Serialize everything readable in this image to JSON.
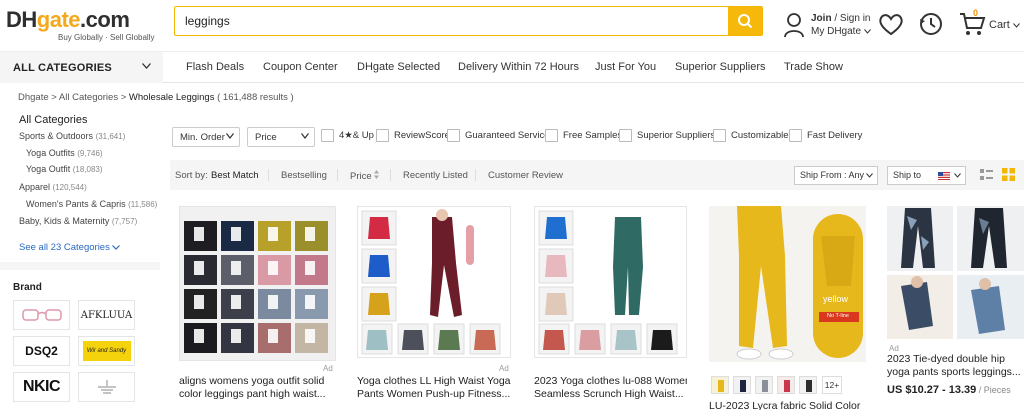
{
  "header": {
    "logo": {
      "dh": "DH",
      "gate": "gate",
      "com": ".com",
      "tagline": "Buy Globally · Sell Globally"
    },
    "search_value": "leggings",
    "user_line1": "Join",
    "user_line1_rest": " / Sign in",
    "user_line2": "My DHgate",
    "cart_count": "0",
    "cart_label": "Cart"
  },
  "nav": {
    "all_categories": "ALL CATEGORIES",
    "items": [
      "Flash Deals",
      "Coupon Center",
      "DHgate Selected",
      "Delivery Within 72 Hours",
      "Just For You",
      "Superior Suppliers",
      "Trade Show"
    ]
  },
  "breadcrumb": {
    "path": "Dhgate > All Categories > ",
    "current": "Wholesale Leggings",
    "count": " ( 161,488  results )"
  },
  "sidebar": {
    "title": "All Categories",
    "items": [
      {
        "label": "Sports & Outdoors",
        "count": "(31,641)"
      },
      {
        "label": "Yoga Outfits",
        "count": "(9,746)"
      },
      {
        "label": "Yoga Outfit",
        "count": "(18,083)"
      },
      {
        "label": "Apparel",
        "count": "(120,544)"
      },
      {
        "label": "Women's Pants & Capris",
        "count": "(11,586)"
      },
      {
        "label": "Baby, Kids & Maternity",
        "count": "(7,757)"
      }
    ],
    "see_all": "See all 23 Categories",
    "brand_title": "Brand",
    "brands": [
      "",
      "AFKLUUA",
      "DSQ2",
      "Wir and Sandy",
      "NKIC",
      ""
    ]
  },
  "filters": {
    "min_order": "Min. Order",
    "price": "Price",
    "checkboxes": [
      "4★& Up",
      "ReviewScore",
      "Guaranteed Service",
      "Free Samples",
      "Superior Suppliers",
      "Customizable",
      "Fast Delivery"
    ]
  },
  "sort": {
    "label": "Sort by:",
    "options": [
      "Best Match",
      "Bestselling",
      "Price",
      "Recently Listed",
      "Customer Review"
    ],
    "ship_from": "Ship From :  Any",
    "ship_to": "Ship to"
  },
  "products": [
    {
      "title": "aligns womens yoga outfit solid",
      "title2": "color leggings pant high waist...",
      "ad": "Ad"
    },
    {
      "title": "Yoga clothes LL High Waist Yoga",
      "title2": "Pants Women Push-up Fitness...",
      "ad": "Ad"
    },
    {
      "title": "2023 Yoga clothes lu-088 Women's",
      "title2": "Seamless Scrunch High Waist...",
      "ad": "Ad"
    },
    {
      "title": "LU-2023 Lycra fabric Solid Color",
      "title2": "",
      "ad": "",
      "badge": "yellow",
      "badge2": "No T-line",
      "more": "12+"
    },
    {
      "title": "2023 Tie-dyed double hip",
      "title2": "yoga pants sports leggings...",
      "ad": "Ad",
      "price": "US $10.27 - 13.39",
      "unit": " / Pieces"
    }
  ],
  "colors": {
    "accent": "#f5b80b",
    "link": "#2a69c1",
    "cart": "#f2920c"
  }
}
